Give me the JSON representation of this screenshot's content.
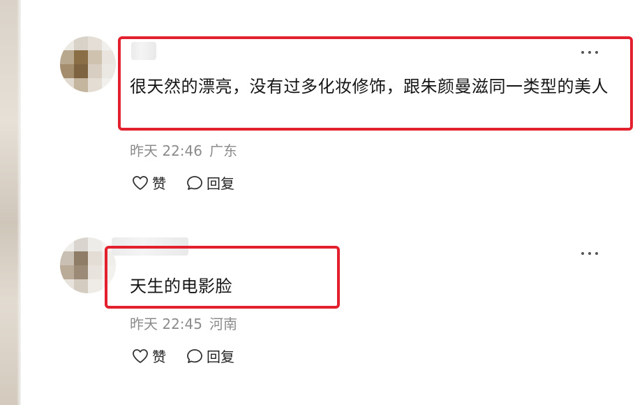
{
  "comments": [
    {
      "text": "很天然的漂亮，没有过多化妆修饰，跟朱颜曼滋同一类型的美人",
      "time": "昨天 22:46",
      "location": "广东",
      "like_label": "赞",
      "reply_label": "回复"
    },
    {
      "text": "天生的电影脸",
      "time": "昨天 22:45",
      "location": "河南",
      "like_label": "赞",
      "reply_label": "回复"
    }
  ],
  "icons": {
    "more": "more-dots-icon",
    "like": "heart-icon",
    "reply": "speech-bubble-icon"
  },
  "colors": {
    "highlight": "#e3202e",
    "meta_text": "#8b8b8b"
  }
}
